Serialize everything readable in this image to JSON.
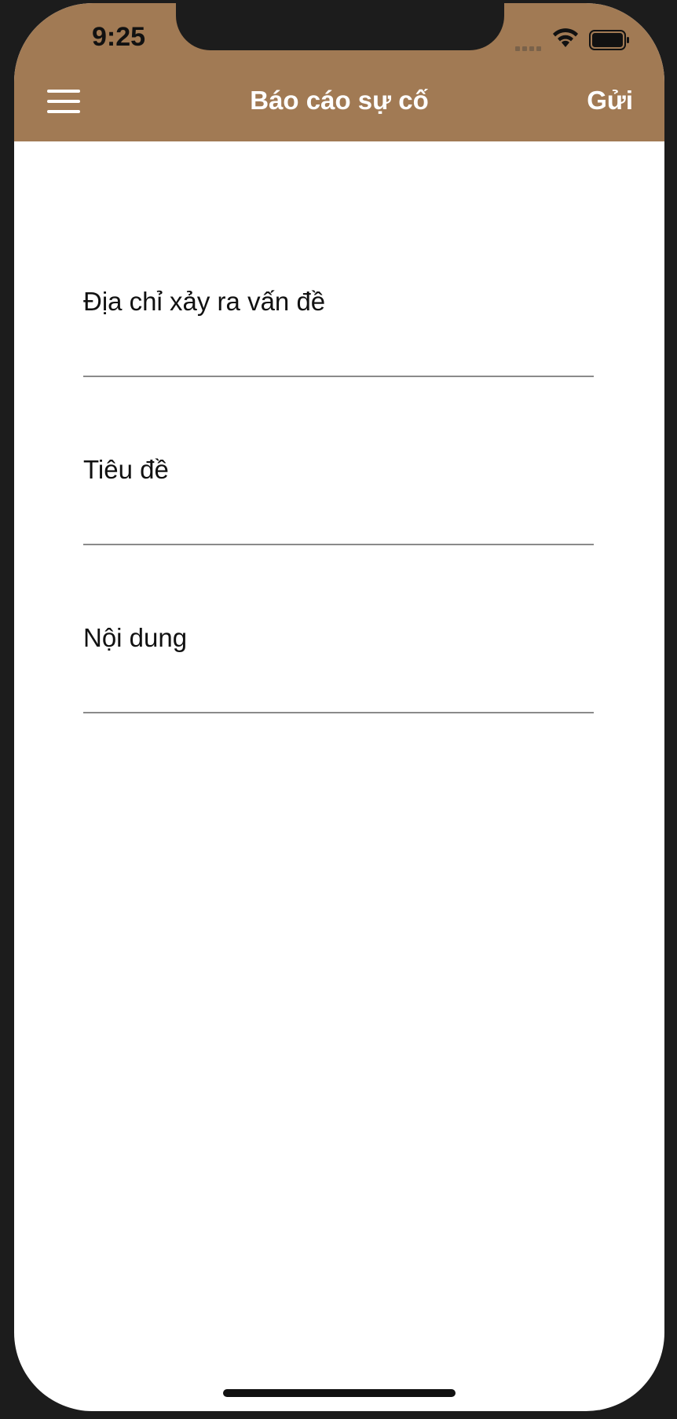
{
  "status_bar": {
    "time": "9:25",
    "icons": [
      "cellular-signal-icon",
      "wifi-icon",
      "battery-icon"
    ]
  },
  "nav": {
    "menu_icon": "hamburger-menu-icon",
    "title": "Báo cáo sự cố",
    "send_label": "Gửi"
  },
  "form": {
    "fields": [
      {
        "label": "Địa chỉ xảy ra vấn đề",
        "value": "",
        "placeholder": ""
      },
      {
        "label": "Tiêu đề",
        "value": "",
        "placeholder": ""
      },
      {
        "label": "Nội dung",
        "value": "",
        "placeholder": ""
      }
    ]
  },
  "colors": {
    "header": "#a17a54",
    "device_frame": "#1c1c1c",
    "background": "#ffffff",
    "underline": "#8a8a8a"
  }
}
